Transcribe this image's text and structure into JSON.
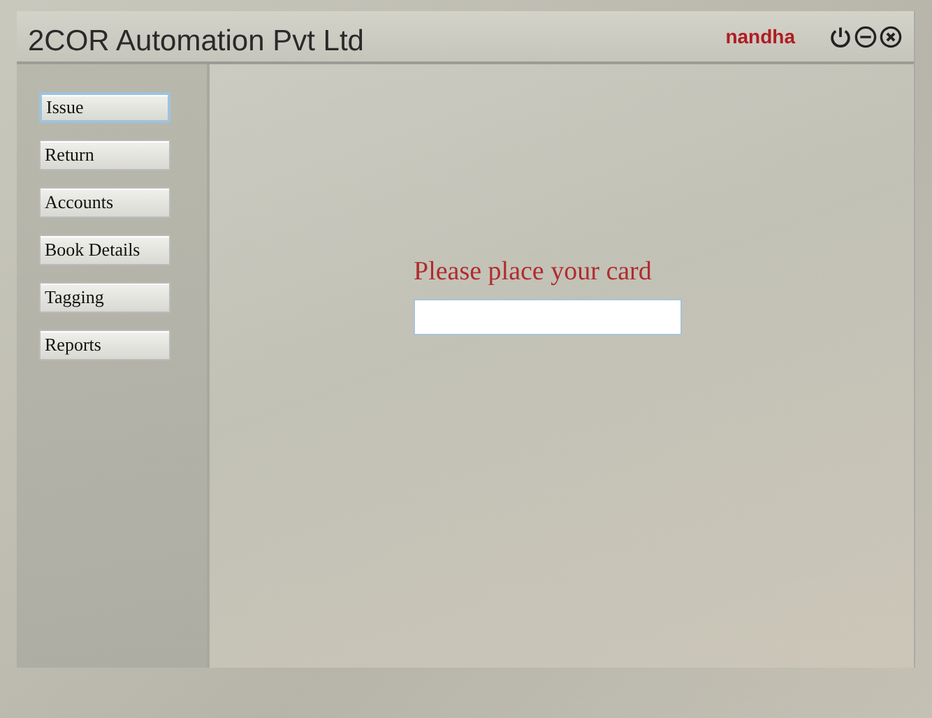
{
  "window": {
    "title": "2COR Automation Pvt Ltd",
    "user": "nandha"
  },
  "sidebar": {
    "items": [
      {
        "label": "Issue",
        "selected": true
      },
      {
        "label": "Return",
        "selected": false
      },
      {
        "label": "Accounts",
        "selected": false
      },
      {
        "label": "Book Details",
        "selected": false
      },
      {
        "label": "Tagging",
        "selected": false
      },
      {
        "label": "Reports",
        "selected": false
      }
    ]
  },
  "card_prompt": {
    "label": "Please place your card"
  }
}
